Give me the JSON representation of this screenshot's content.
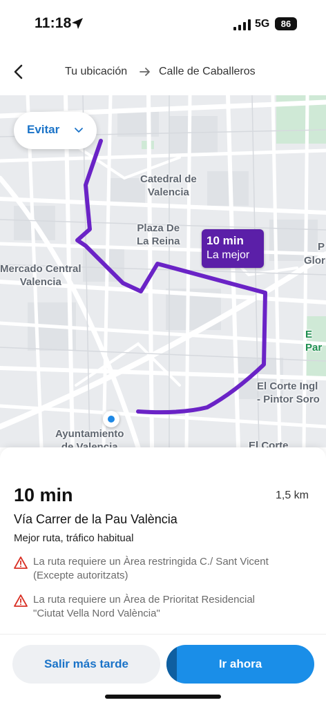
{
  "status_bar": {
    "time": "11:18",
    "network": "5G",
    "battery": "86"
  },
  "header": {
    "from": "Tu ubicación",
    "to": "Calle de Caballeros"
  },
  "map": {
    "avoid_label": "Evitar",
    "labels": {
      "cathedral": "Catedral de\nValencia",
      "plaza": "Plaza De\nLa Reina",
      "market": "Mercado Central\nValencia",
      "ayuntamiento": "Ayuntamiento\nde Valencia",
      "corte_ingles": "El Corte Ingl\n- Pintor Soro",
      "corte_ingles_2": "El Corte",
      "edge_p": "P",
      "edge_glo": "Glor",
      "edge_parq": "E\nPar"
    },
    "route_badge": {
      "time": "10 min",
      "label": "La mejor"
    },
    "route_color": "#6a23c6"
  },
  "sheet": {
    "eta": "10 min",
    "distance": "1,5 km",
    "route_name": "Vía Carrer de la Pau València",
    "route_desc": "Mejor ruta, tráfico habitual",
    "warnings": [
      {
        "line1": "La ruta requiere un Àrea restringida C./ Sant Vicent",
        "line2": "(Excepte autoritzats)"
      },
      {
        "line1": "La ruta requiere un Àrea de Prioritat Residencial",
        "line2": "\"Ciutat Vella Nord València\""
      }
    ],
    "later_button": "Salir más tarde",
    "go_button": "Ir ahora",
    "go_progress": 0.07
  },
  "icons": {
    "back": "chevron-left-icon",
    "arrow": "arrow-right-icon",
    "warning": "warning-triangle-icon",
    "location": "location-arrow-icon",
    "signal": "signal-icon",
    "origin": "origin-dot-icon"
  },
  "colors": {
    "accent": "#1a73c8",
    "go_button": "#1a8ee8",
    "route": "#6a23c6",
    "warning": "#d93025"
  }
}
